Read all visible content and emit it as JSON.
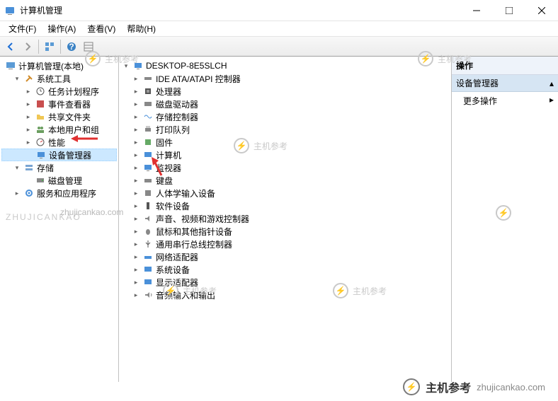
{
  "window": {
    "title": "计算机管理"
  },
  "menu": {
    "file": "文件(F)",
    "action": "操作(A)",
    "view": "查看(V)",
    "help": "帮助(H)"
  },
  "left_tree": {
    "root": "计算机管理(本地)",
    "system_tools": "系统工具",
    "task_scheduler": "任务计划程序",
    "event_viewer": "事件查看器",
    "shared_folders": "共享文件夹",
    "local_users": "本地用户和组",
    "performance": "性能",
    "device_manager": "设备管理器",
    "storage": "存储",
    "disk_management": "磁盘管理",
    "services_apps": "服务和应用程序"
  },
  "center_tree": {
    "root": "DESKTOP-8E5SLCH",
    "ide": "IDE ATA/ATAPI 控制器",
    "processors": "处理器",
    "disk_drives": "磁盘驱动器",
    "storage_ctrl": "存储控制器",
    "print_queues": "打印队列",
    "firmware": "固件",
    "computer": "计算机",
    "monitors": "监视器",
    "keyboards": "键盘",
    "hid": "人体学输入设备",
    "software_dev": "软件设备",
    "sound": "声音、视频和游戏控制器",
    "mice": "鼠标和其他指针设备",
    "usb": "通用串行总线控制器",
    "network": "网络适配器",
    "system_devices": "系统设备",
    "display": "显示适配器",
    "audio_io": "音频输入和输出"
  },
  "actions": {
    "header": "操作",
    "section": "设备管理器",
    "more": "更多操作"
  },
  "watermarks": {
    "text": "主机参考",
    "url": "zhujicankao.com",
    "domain": "ZHUJICANKAO"
  }
}
